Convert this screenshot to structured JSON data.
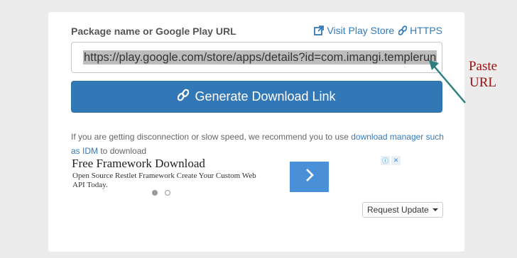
{
  "form": {
    "label": "Package name or Google Play URL",
    "visit_link": "Visit Play Store",
    "https_link": "HTTPS",
    "input_value": "https://play.google.com/store/apps/details?id=com.imangi.templerun"
  },
  "generate_button": {
    "label": "Generate Download Link"
  },
  "info": {
    "text_before": "If you are getting disconnection or slow speed, we recommend you to use ",
    "link": "download manager such as IDM",
    "text_after": " to download"
  },
  "ad": {
    "title": "Free Framework Download",
    "description": "Open Source Restlet Framework Create Your Custom Web API Today.",
    "choices_icon": "ⓘ",
    "close_icon": "✕"
  },
  "request_update": {
    "label": "Request Update"
  },
  "annotation": {
    "line1": "Paste",
    "line2": "URL"
  },
  "colors": {
    "accent": "#3278b7",
    "annotation": "#9a0f0f",
    "arrow": "#2f7f7f"
  },
  "icons": {
    "external_link": "external-link-icon",
    "link": "link-icon",
    "chevron": "chevron-right-icon",
    "caret": "caret-down-icon"
  }
}
